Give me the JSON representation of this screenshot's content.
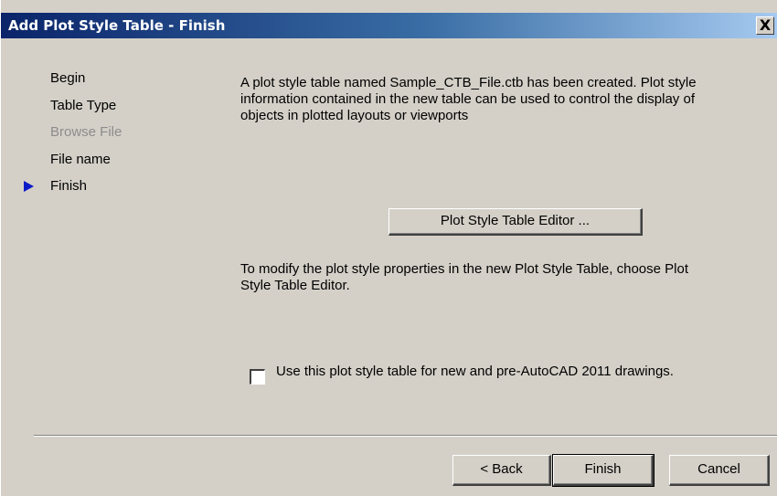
{
  "window": {
    "title": "Add Plot Style Table - Finish",
    "close_label": "X"
  },
  "steps": [
    {
      "label": "Begin",
      "state": "normal"
    },
    {
      "label": "Table Type",
      "state": "normal"
    },
    {
      "label": "Browse File",
      "state": "disabled"
    },
    {
      "label": "File name",
      "state": "normal"
    },
    {
      "label": "Finish",
      "state": "current"
    }
  ],
  "main": {
    "info_text": "A plot style table named Sample_CTB_File.ctb has been created. Plot style information contained in the new table can be used to control the display of objects in plotted layouts or viewports",
    "editor_button_label": "Plot Style Table Editor ...",
    "modify_text": "To modify the plot style properties in the new Plot Style Table, choose Plot Style Table Editor.",
    "checkbox_label": "Use this plot style table for new and pre-AutoCAD 2011 drawings.",
    "checkbox_checked": false
  },
  "footer": {
    "back_label": "< Back",
    "finish_label": "Finish",
    "cancel_label": "Cancel"
  },
  "colors": {
    "dialog_background": "#d4d0c8",
    "title_gradient_start": "#0a246a",
    "title_gradient_end": "#a6caf0",
    "current_step_arrow": "#0b1ac7",
    "disabled_text": "#8c8c8c"
  },
  "icons": {
    "current_step": "triangle-right-icon",
    "close": "close-icon"
  }
}
